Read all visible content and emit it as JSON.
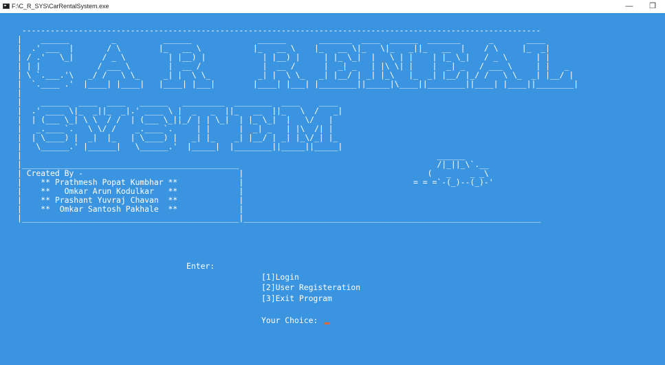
{
  "window": {
    "title": "F:\\C_R_SYS\\CarRentalSystem.exe",
    "minimize_glyph": "—",
    "restore_glyph": "❐"
  },
  "console": {
    "banner_text": " --------------------------------------------------------------------------------------------------------------\n|    ______         _          ______              ______       _______  ____  ______  _______      _       ____  \n|  .' ___  |       / \\        |_   __ \\           |_   __ \\    |_   __ \\|_   \\|_   _||_   __  |    / \\     |_  _| \n| / .'   \\_|      / _ \\         | |__) |            | |__) |     | |_ \\_|  |   \\ | |    | |_ \\_|   / _ \\      | |   \n| | |            / ___ \\        |  __ /             |  __ /      |  _| _   | |\\ \\| |    |  _| _   / ___ \\     | |   _\n| \\ `.___.'\\   _/ /   \\ \\_     _| |  \\ \\_          _| |  \\ \\_   _| |__/ | _| |_\\   |_  _| |__/ |_/ /   \\ \\_  _| |__/ |\n|  `.____ .'  |____| |____|   |____| |___|        |____| |___| |________||_____|\\____||________||____| |____||________|\n|\n|    ______  ____  ____   ______   _________  ________  ____    ____\n|  .' ____ \\|_  _||_  _|.' ____ \\ |  _   _  ||_   __  ||_   \\  /   _|\n|  | (___ \\_| \\ \\  / /  | (___ \\_||_/ | | \\_|  | |_ \\_|  |   \\/   |\n|   _.____`.   \\ \\/ /    _.____`.     | |      |  _| _   | |\\  /| |\n|  | \\____) |  _|  |_   | \\____) |   _| |_    _| |__/ | _| |_\\/_| |_\n|   \\______.' |______|   \\______.'  |_____|  |________||_____||_____|\n|                                                                                        ______\n|______________________________________________                                          /|_||_\\`.__\n| Created By -                                 |                                       (   _    _ _\\\n|    ** Prathmesh Popat Kumbhar **             |                                    = = =`-(_)--(_)-'\n|    **   Omkar Arun Kodulkar   **             |\n|    ** Prashant Yuvraj Chavan  **             |\n|    **  Omkar Santosh Pakhale  **             |\n|______________________________________________|_______________________________________________________________"
  },
  "menu": {
    "prompt": "Enter:",
    "options": [
      "[1]Login",
      "[2]User Registeration",
      "[3]Exit Program"
    ],
    "choice_prompt": "Your Choice: "
  },
  "colors": {
    "console_background": "#3b94e0",
    "text": "#ffffff",
    "cursor": "#e2683a"
  }
}
